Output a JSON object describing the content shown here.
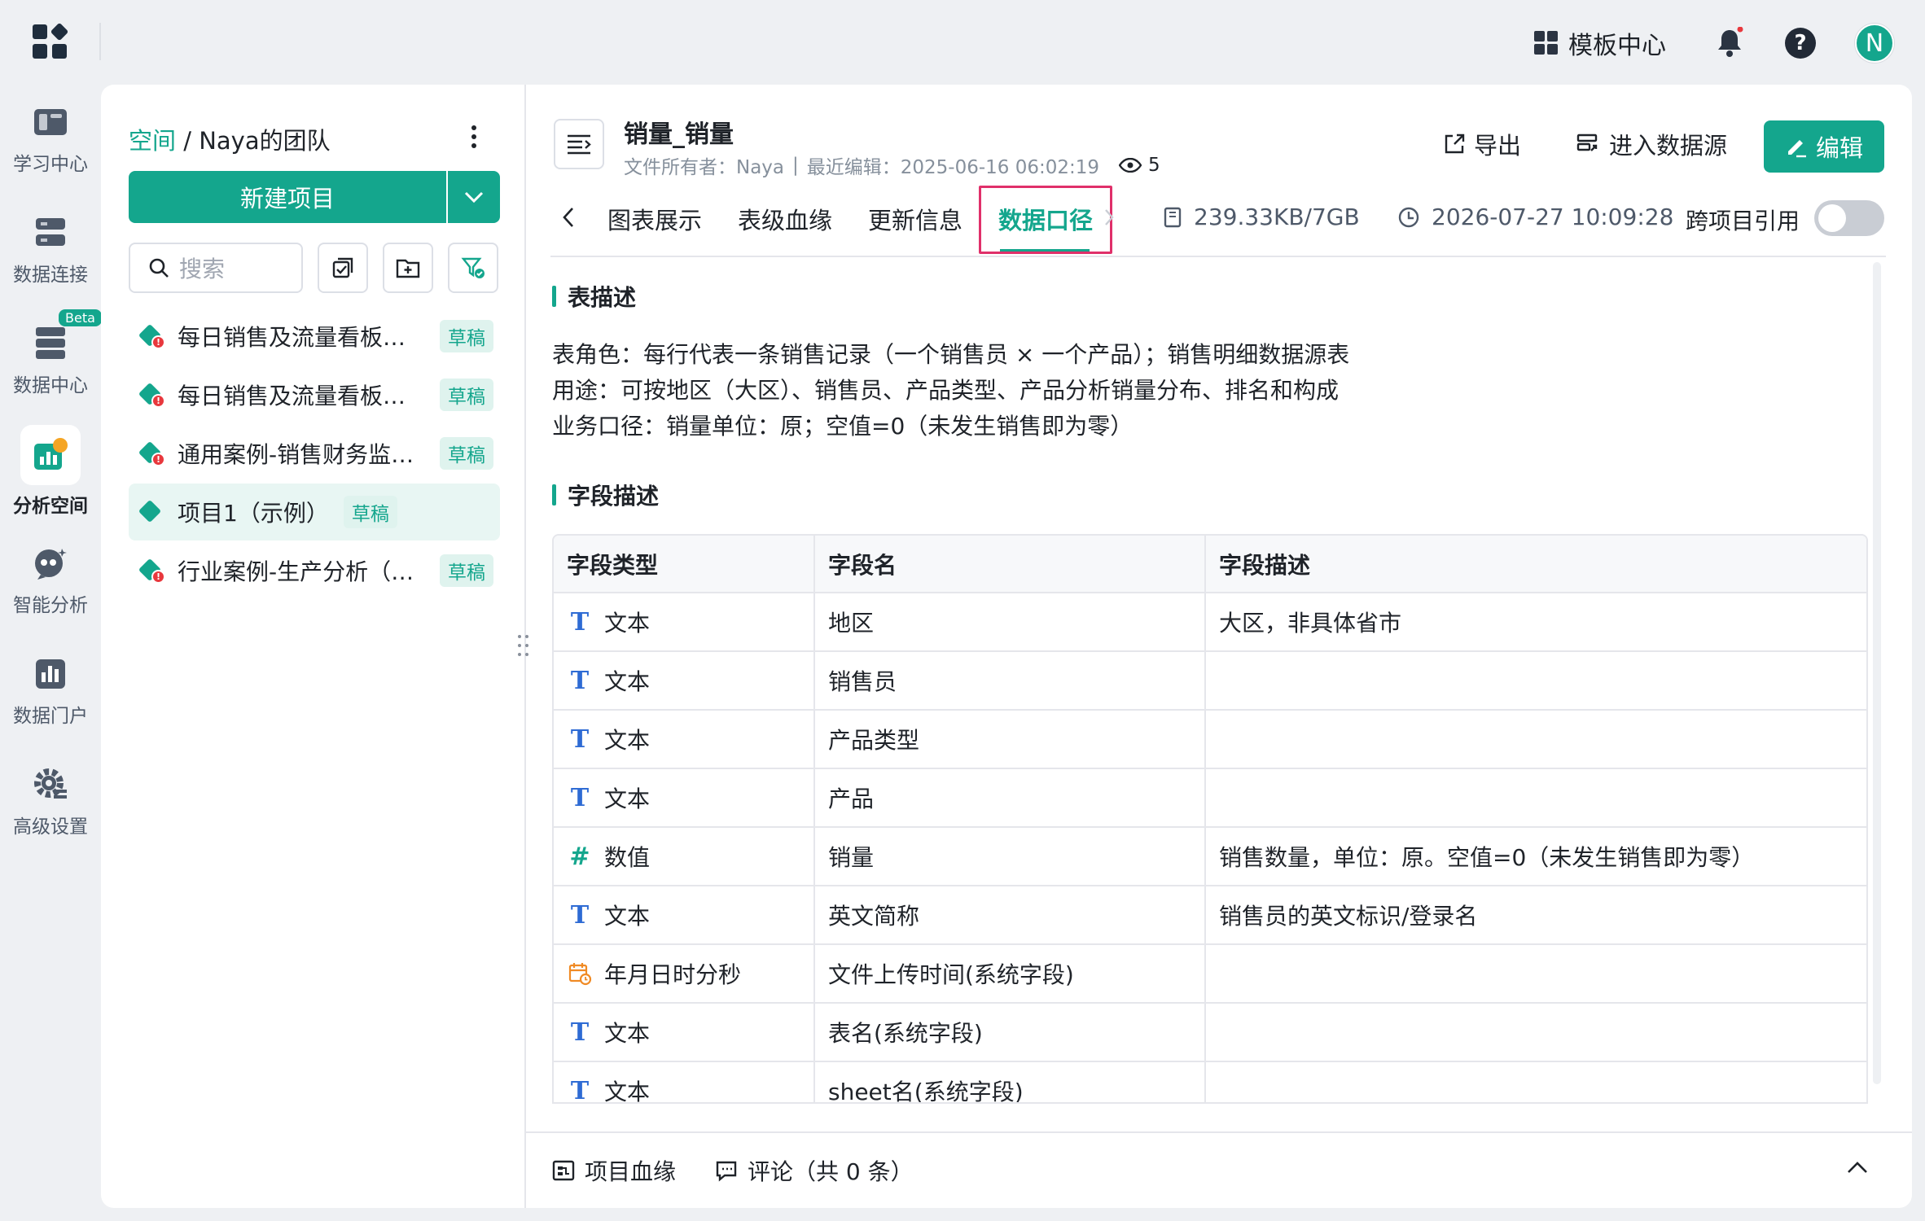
{
  "topbar": {
    "template_center": "模板中心",
    "avatar_letter": "N"
  },
  "rail": {
    "items": [
      {
        "label": "学习中心",
        "icon": "book-icon"
      },
      {
        "label": "数据连接",
        "icon": "database-connect-icon"
      },
      {
        "label": "数据中心",
        "icon": "data-center-icon",
        "badge": "Beta"
      },
      {
        "label": "分析空间",
        "icon": "analysis-space-icon",
        "active": true
      },
      {
        "label": "智能分析",
        "icon": "ai-chat-icon"
      },
      {
        "label": "数据门户",
        "icon": "portal-icon"
      },
      {
        "label": "高级设置",
        "icon": "gear-icon"
      }
    ]
  },
  "left": {
    "breadcrumb_link": "空间",
    "breadcrumb_rest": " / Naya的团队",
    "new_project": "新建项目",
    "search_placeholder": "搜索",
    "projects": [
      {
        "name": "每日销售及流量看板（…",
        "badge": "草稿"
      },
      {
        "name": "每日销售及流量看板（…",
        "badge": "草稿"
      },
      {
        "name": "通用案例-销售财务监…",
        "badge": "草稿"
      },
      {
        "name": "项目1（示例）",
        "badge": "草稿"
      },
      {
        "name": "行业案例-生产分析（…",
        "badge": "草稿"
      }
    ]
  },
  "doc": {
    "title": "销量_销量",
    "owner": "文件所有者：Naya",
    "sep": "|",
    "last_edit": "最近编辑：2025-06-16 06:02:19",
    "views": "5",
    "export": "导出",
    "enter_source": "进入数据源",
    "edit": "编辑"
  },
  "tabs": {
    "items": [
      "图表展示",
      "表级血缘",
      "更新信息",
      "数据口径"
    ],
    "size": "239.33KB/7GB",
    "time": "2026-07-27 10:09:28",
    "cross_ref": "跨项目引用"
  },
  "table_desc": {
    "title": "表描述",
    "lines": [
      "表角色：每行代表一条销售记录（一个销售员 × 一个产品）；销售明细数据源表",
      "用途：可按地区（大区）、销售员、产品类型、产品分析销量分布、排名和构成",
      "业务口径：销量单位：原；空值=0（未发生销售即为零）"
    ]
  },
  "field_desc": {
    "title": "字段描述",
    "headers": [
      "字段类型",
      "字段名",
      "字段描述"
    ],
    "rows": [
      {
        "type": "文本",
        "name": "地区",
        "desc": "大区，非具体省市"
      },
      {
        "type": "文本",
        "name": "销售员",
        "desc": ""
      },
      {
        "type": "文本",
        "name": "产品类型",
        "desc": ""
      },
      {
        "type": "文本",
        "name": "产品",
        "desc": ""
      },
      {
        "type": "数值",
        "name": "销量",
        "desc": "销售数量，单位：原。空值=0（未发生销售即为零）"
      },
      {
        "type": "文本",
        "name": "英文简称",
        "desc": "销售员的英文标识/登录名"
      },
      {
        "type": "年月日时分秒",
        "name": "文件上传时间(系统字段)",
        "desc": ""
      },
      {
        "type": "文本",
        "name": "表名(系统字段)",
        "desc": ""
      },
      {
        "type": "文本",
        "name": "sheet名(系统字段)",
        "desc": ""
      }
    ]
  },
  "footer": {
    "lineage": "项目血缘",
    "comments": "评论（共 0 条）"
  }
}
